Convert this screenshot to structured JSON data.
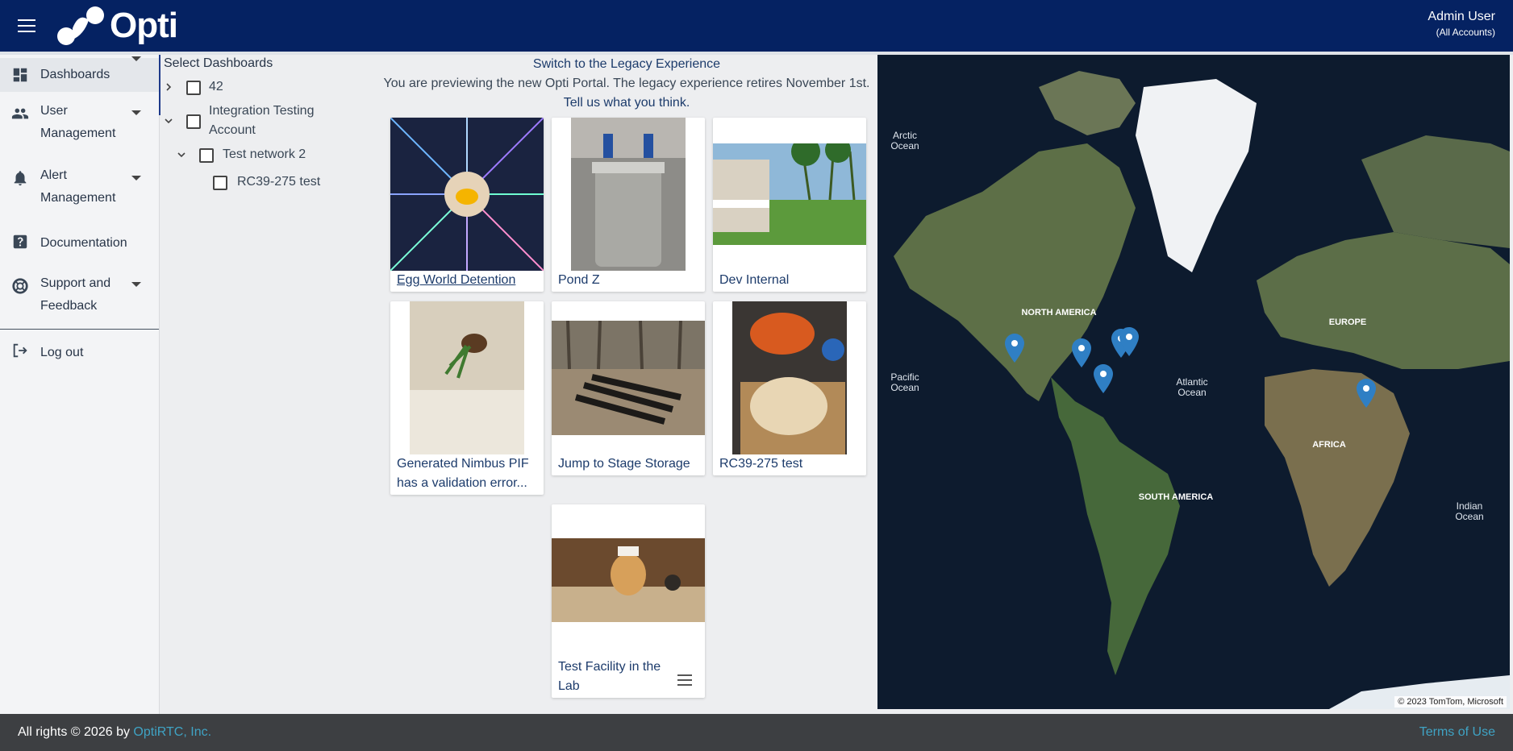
{
  "header": {
    "logo_text": "Opti",
    "user_name": "Admin User",
    "user_account": "(All Accounts)"
  },
  "sidebar": {
    "items": [
      {
        "label": "Dashboards",
        "icon": "dashboard-icon"
      },
      {
        "label": "User Management",
        "icon": "people-icon"
      },
      {
        "label": "Alert Management",
        "icon": "bell-icon"
      },
      {
        "label": "Documentation",
        "icon": "help-icon"
      },
      {
        "label": "Support and Feedback",
        "icon": "lifebuoy-icon"
      },
      {
        "label": "Log out",
        "icon": "logout-icon"
      }
    ]
  },
  "tree": {
    "title": "Select Dashboards",
    "nodes": [
      {
        "label": "42"
      },
      {
        "label": "Integration Testing Account"
      },
      {
        "label": "Test network 2"
      },
      {
        "label": "RC39-275 test"
      }
    ]
  },
  "banner": {
    "switch_link": "Switch to the Legacy Experience",
    "preview_text": "You are previewing the new Opti Portal. The legacy experience retires November 1st.",
    "feedback_link": "Tell us what you think."
  },
  "cards": [
    {
      "caption": "Egg World Detention"
    },
    {
      "caption": "Pond Z"
    },
    {
      "caption": "Dev Internal"
    },
    {
      "caption": "Generated Nimbus PIF has a validation error..."
    },
    {
      "caption": "Jump to Stage Storage"
    },
    {
      "caption": "RC39-275 test"
    },
    {
      "caption": "Test Facility in the Lab"
    }
  ],
  "map": {
    "labels": {
      "arctic": "Arctic Ocean",
      "north_america": "NORTH AMERICA",
      "europe": "EUROPE",
      "pacific": "Pacific Ocean",
      "atlantic": "Atlantic Ocean",
      "africa": "AFRICA",
      "south_america": "SOUTH AMERICA",
      "indian": "Indian Ocean"
    },
    "attribution": "© 2023 TomTom, Microsoft",
    "pin_color": "#2f7fc4"
  },
  "footer": {
    "copyright": "All rights © 2026 by",
    "company": "OptiRTC, Inc.",
    "terms": "Terms of Use"
  },
  "colors": {
    "header_bg": "#052262",
    "footer_bg": "#3d3f42",
    "link": "#1c3b6b",
    "footer_link": "#3fa3c4"
  }
}
